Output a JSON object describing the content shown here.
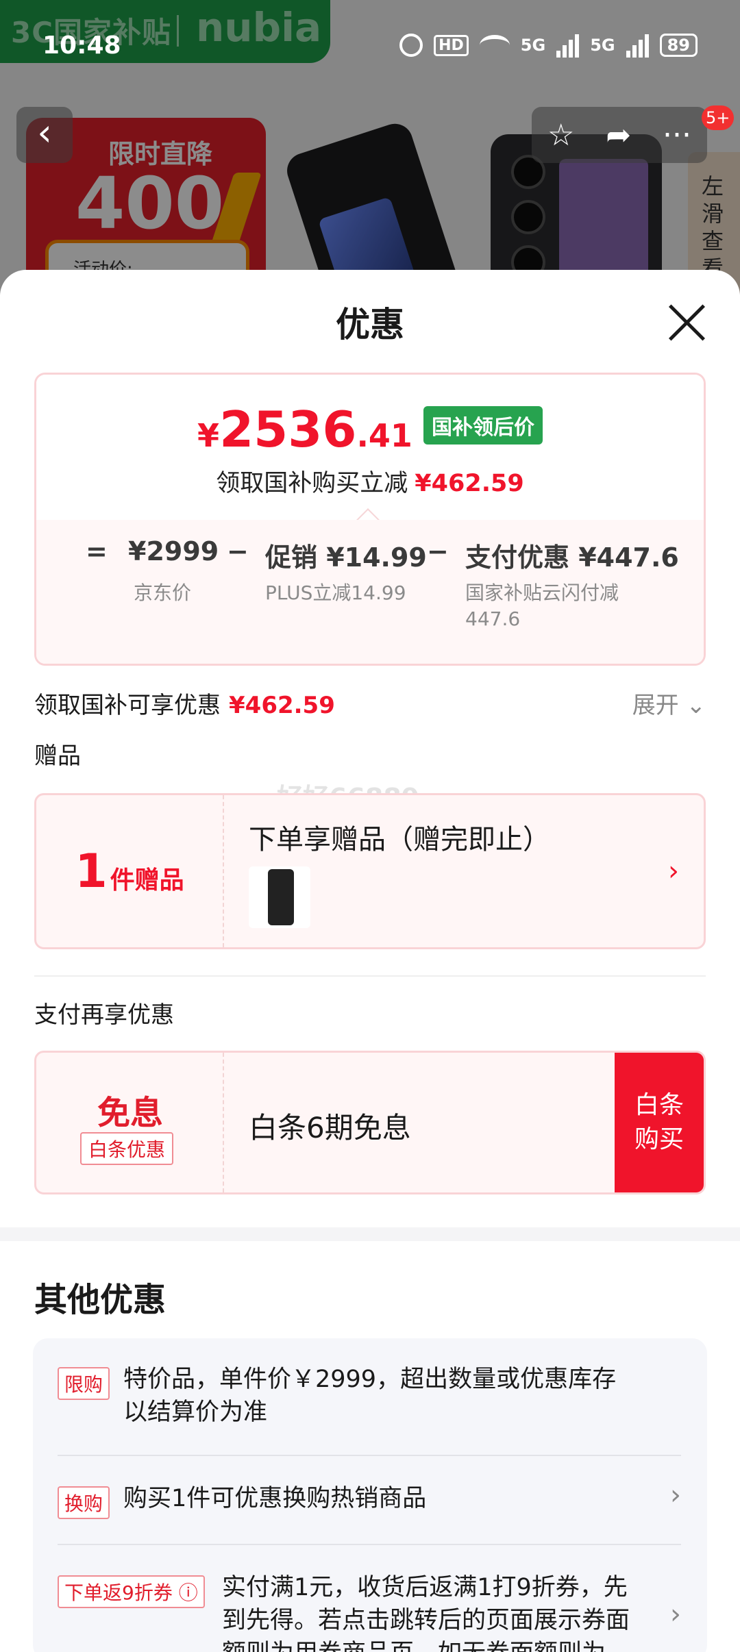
{
  "status_bar": {
    "time": "10:48",
    "hd_label": "HD",
    "net1": "5G",
    "net2": "5G",
    "battery": "89"
  },
  "background": {
    "brand_left": "3C国家补贴",
    "brand_right": "nubia",
    "promo_line1": "限时直降",
    "promo_line2": "400",
    "promo_price_label": "活动价:",
    "side_tab": "左滑查看",
    "notif_badge": "5+"
  },
  "sheet": {
    "title": "优惠",
    "price": {
      "currency": "¥",
      "integer": "2536",
      "decimal": ".41",
      "tag": "国补领后价",
      "save_label": "领取国补购买立减",
      "save_amount": "¥462.59"
    },
    "calc": {
      "eq": "=",
      "jd_price": "¥2999",
      "jd_label": "京东价",
      "minus1": "−",
      "promo": "促销 ¥14.99",
      "promo_label": "PLUS立减14.99",
      "minus2": "−",
      "pay": "支付优惠 ¥447.6",
      "pay_label_1": "国家补贴云闪付减",
      "pay_label_2": "447.6"
    },
    "discount": {
      "label": "领取国补可享优惠",
      "amount": "¥462.59",
      "expand": "展开"
    },
    "gift": {
      "heading": "赠品",
      "count": "1",
      "unit": "件赠品",
      "title": "下单享赠品（赠完即止）"
    },
    "watermark": "好好66889",
    "payment": {
      "heading": "支付再享优惠",
      "big": "免息",
      "tag": "白条优惠",
      "text": "白条6期免息",
      "btn_line1": "白条",
      "btn_line2": "购买"
    },
    "other": {
      "heading": "其他优惠",
      "items": [
        {
          "tag": "限购",
          "line1": "特价品，单件价￥2999，超出数量或优惠库存",
          "line2": "以结算价为准"
        },
        {
          "tag": "换购",
          "line1": "购买1件可优惠换购热销商品"
        },
        {
          "tag": "下单返9折券",
          "line1": "实付满1元，收货后返满1打9折券，先",
          "line2": "到先得。若点击跳转后的页面展示券面",
          "line3": "额则为用券商品页，如无券面额则为..."
        }
      ]
    }
  },
  "colors": {
    "accent_red": "#f0142b",
    "tag_green": "#27a34f",
    "brand_green": "#1e9f4a",
    "card_border": "#f9d3d6",
    "card_bg": "#fff6f6"
  }
}
